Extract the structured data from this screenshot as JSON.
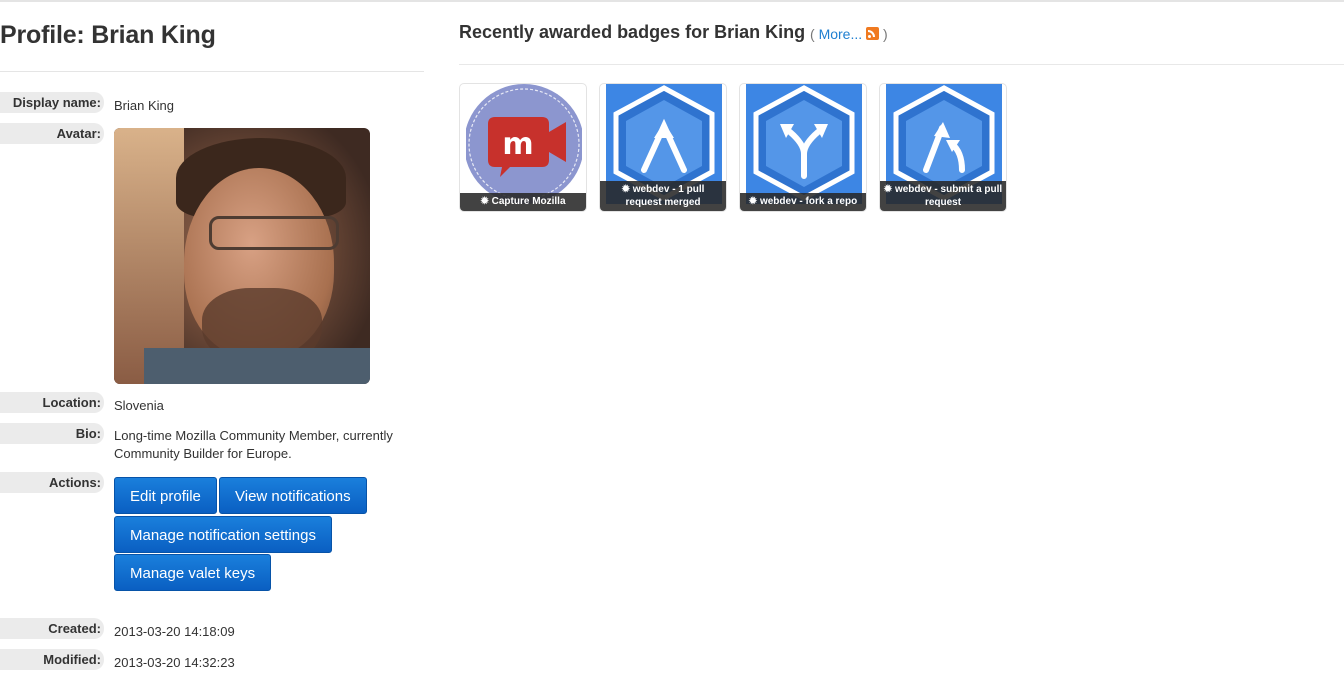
{
  "profile": {
    "title": "Profile: Brian King",
    "fields": {
      "display_name": {
        "label": "Display name:",
        "value": "Brian King"
      },
      "avatar": {
        "label": "Avatar:"
      },
      "location": {
        "label": "Location:",
        "value": "Slovenia"
      },
      "bio": {
        "label": "Bio:",
        "value": "Long-time Mozilla Community Member, currently Community Builder for Europe."
      },
      "actions": {
        "label": "Actions:"
      },
      "created": {
        "label": "Created:",
        "value": "2013-03-20 14:18:09"
      },
      "modified": {
        "label": "Modified:",
        "value": "2013-03-20 14:32:23"
      }
    },
    "actions": {
      "edit_profile": "Edit profile",
      "view_notifications": "View notifications",
      "manage_notification_settings": "Manage notification settings",
      "manage_valet_keys": "Manage valet keys"
    }
  },
  "badges": {
    "title": "Recently awarded badges for Brian King",
    "open_paren": "(",
    "more_label": "More...",
    "close_paren": ")",
    "feed_icon": "rss-icon",
    "items": [
      {
        "name": "Capture Mozilla",
        "icon": "mozilla-camera-badge"
      },
      {
        "name": "webdev - 1 pull request merged",
        "icon": "merge-arrows-badge"
      },
      {
        "name": "webdev - fork a repo",
        "icon": "fork-arrows-badge"
      },
      {
        "name": "webdev - submit a pull request",
        "icon": "pull-request-badge"
      }
    ]
  },
  "colors": {
    "button": "#0a5fc2",
    "link": "#1f7fd0",
    "label_bg": "#ebebeb",
    "badge_blue": "#3d86e4"
  }
}
